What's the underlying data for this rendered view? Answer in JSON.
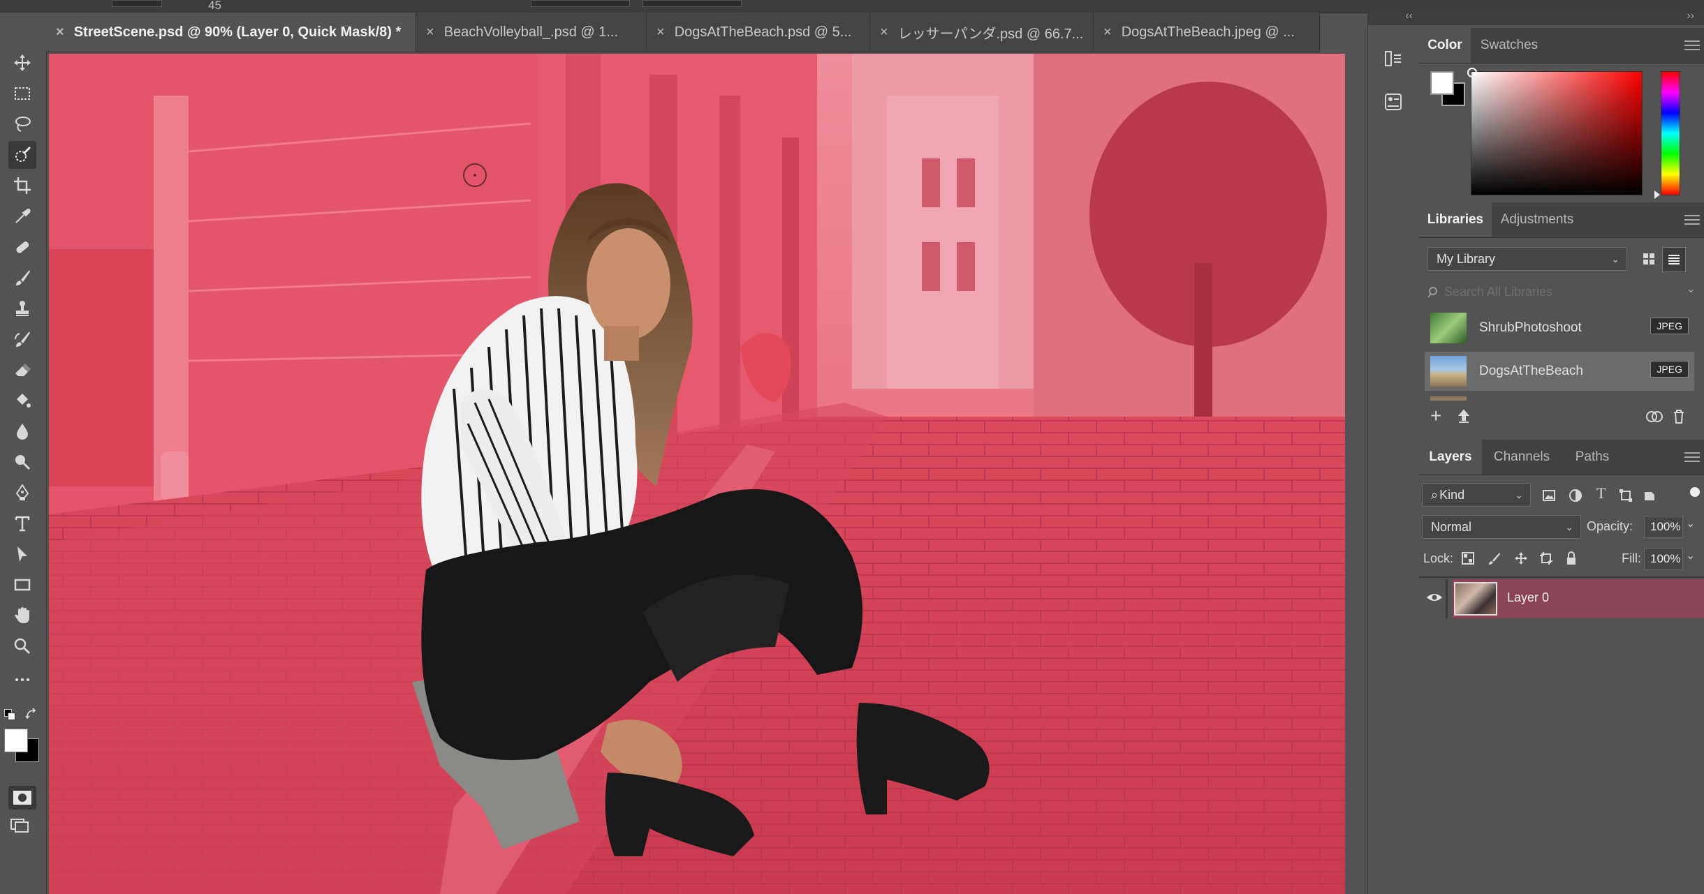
{
  "options_bar": {
    "size_value": "45"
  },
  "tabs": [
    {
      "label": "StreetScene.psd @ 90% (Layer 0, Quick Mask/8) *",
      "active": true
    },
    {
      "label": "BeachVolleyball_.psd @ 1..."
    },
    {
      "label": "DogsAtTheBeach.psd @ 5..."
    },
    {
      "label": "レッサーパンダ.psd @ 66.7..."
    },
    {
      "label": "DogsAtTheBeach.jpeg @ ..."
    }
  ],
  "tools": [
    "move-icon",
    "marquee-icon",
    "lasso-icon",
    "quick-selection-icon",
    "crop-icon",
    "eyedropper-icon",
    "healing-brush-icon",
    "brush-icon",
    "clone-stamp-icon",
    "history-brush-icon",
    "eraser-icon",
    "paint-bucket-icon",
    "blur-icon",
    "dodge-icon",
    "pen-icon",
    "type-icon",
    "path-selection-icon",
    "rectangle-icon",
    "hand-icon",
    "zoom-icon",
    "more-tools-icon"
  ],
  "color_panel": {
    "tabs": [
      "Color",
      "Swatches"
    ],
    "foreground": "#ffffff",
    "background": "#000000",
    "hue": "#ff0000"
  },
  "libraries_panel": {
    "tabs": [
      "Libraries",
      "Adjustments"
    ],
    "library_select": "My Library",
    "search_placeholder": "Search All Libraries",
    "items": [
      {
        "name": "ShrubPhotoshoot",
        "badge": "JPEG"
      },
      {
        "name": "DogsAtTheBeach",
        "badge": "JPEG"
      }
    ]
  },
  "layers_panel": {
    "tabs": [
      "Layers",
      "Channels",
      "Paths"
    ],
    "filter_kind": "Kind",
    "blend_mode": "Normal",
    "opacity_label": "Opacity:",
    "opacity_value": "100%",
    "lock_label": "Lock:",
    "fill_label": "Fill:",
    "fill_value": "100%",
    "layers": [
      {
        "name": "Layer 0"
      }
    ]
  },
  "colors": {
    "quick_mask_overlay": "#e8485e",
    "selected_layer": "#8a4455",
    "panel_bg": "#535353"
  }
}
